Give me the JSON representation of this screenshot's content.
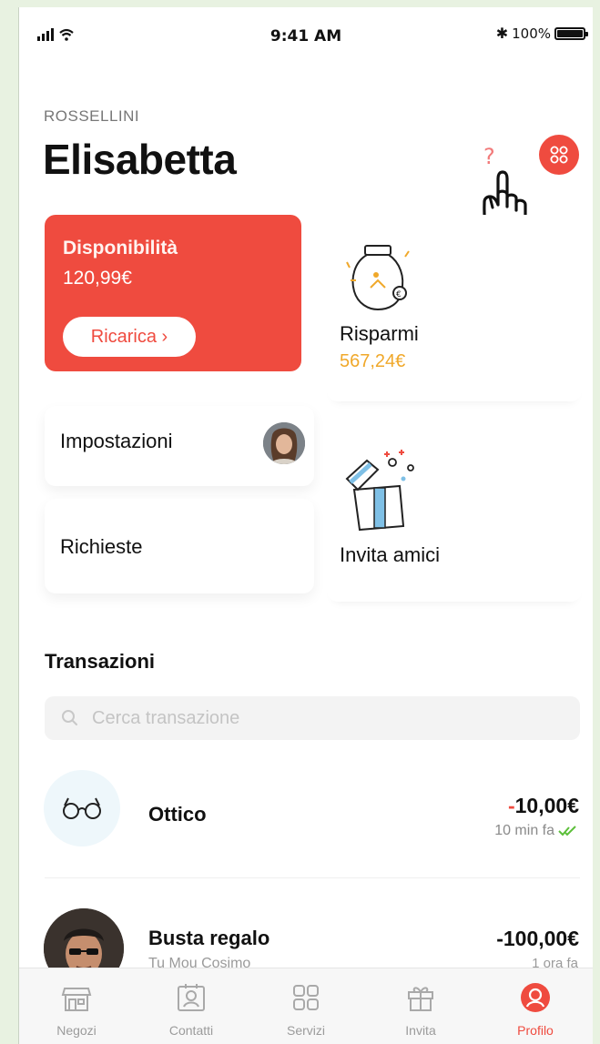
{
  "status_bar": {
    "signal": "ıll",
    "time": "9:41 AM",
    "bluetooth": "✱",
    "battery_text": "100%",
    "battery_level": 1.0
  },
  "profile": {
    "surname": "ROSSELLINI",
    "name": "Elisabetta",
    "help_icon_text": "?"
  },
  "cards": {
    "availability": {
      "label": "Disponibilità",
      "amount": "120,99€",
      "button": "Ricarica ›"
    },
    "savings": {
      "label": "Risparmi",
      "amount": "567,24€"
    },
    "settings": {
      "label": "Impostazioni"
    },
    "requests": {
      "label": "Richieste"
    },
    "invite": {
      "label": "Invita amici"
    }
  },
  "transactions": {
    "title": "Transazioni",
    "search_placeholder": "Cerca transazione",
    "items": [
      {
        "name": "Ottico",
        "amount_sign": "-",
        "amount": "10,00€",
        "time": "10 min fa",
        "status_icon": "double-check-icon"
      },
      {
        "name": "Busta regalo",
        "amount_sign": "-",
        "amount": "100,00€",
        "subtitle": "Tu Mou Cosimo",
        "time": "1 ora fa"
      }
    ]
  },
  "tabbar": [
    {
      "label": "Negozi",
      "icon": "store-icon",
      "active": false
    },
    {
      "label": "Contatti",
      "icon": "contacts-icon",
      "active": false
    },
    {
      "label": "Servizi",
      "icon": "services-icon",
      "active": false
    },
    {
      "label": "Invita",
      "icon": "gift-icon",
      "active": false
    },
    {
      "label": "Profilo",
      "icon": "profile-icon",
      "active": true
    }
  ],
  "colors": {
    "accent": "#ef4b3f",
    "savings_amount": "#f0a82a",
    "check_green": "#5cbf3a"
  }
}
